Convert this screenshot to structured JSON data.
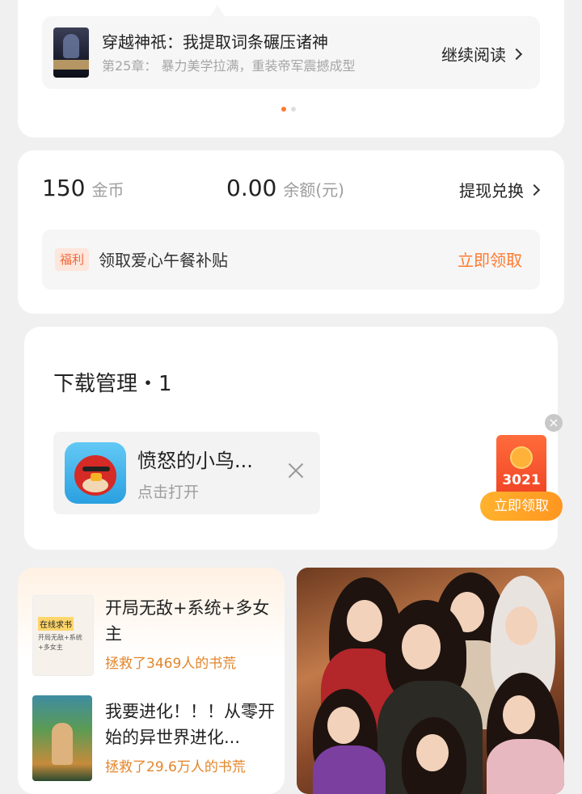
{
  "reading": {
    "book_title": "穿越神祇：我提取词条碾压诸神",
    "chapter": "第25章： 暴力美学拉满，重装帝军震撼成型",
    "continue_label": "继续阅读"
  },
  "wallet": {
    "coins_value": "150",
    "coins_unit": "金币",
    "balance_value": "0.00",
    "balance_unit": "余额(元)",
    "withdraw_label": "提现兑换",
    "welfare_tag": "福利",
    "welfare_text": "领取爱心午餐补贴",
    "welfare_claim": "立即领取"
  },
  "downloads": {
    "title": "下载管理・1",
    "app_name": "愤怒的小鸟...",
    "app_action": "点击打开"
  },
  "red_packet": {
    "count": "3021",
    "claim_label": "立即领取",
    "close_icon": "×"
  },
  "recommendations": [
    {
      "title": "开局无敌+系统+多女主",
      "subtitle": "拯救了3469人的书荒",
      "cover_tag": "在线求书",
      "cover_sub": "开局无敌+系统+多女主"
    },
    {
      "title": "我要进化！！！从零开始的异世界进化...",
      "subtitle": "拯救了29.6万人的书荒"
    }
  ],
  "colors": {
    "accent": "#ff7a2f",
    "background": "#f0f0f0",
    "card": "#ffffff"
  }
}
